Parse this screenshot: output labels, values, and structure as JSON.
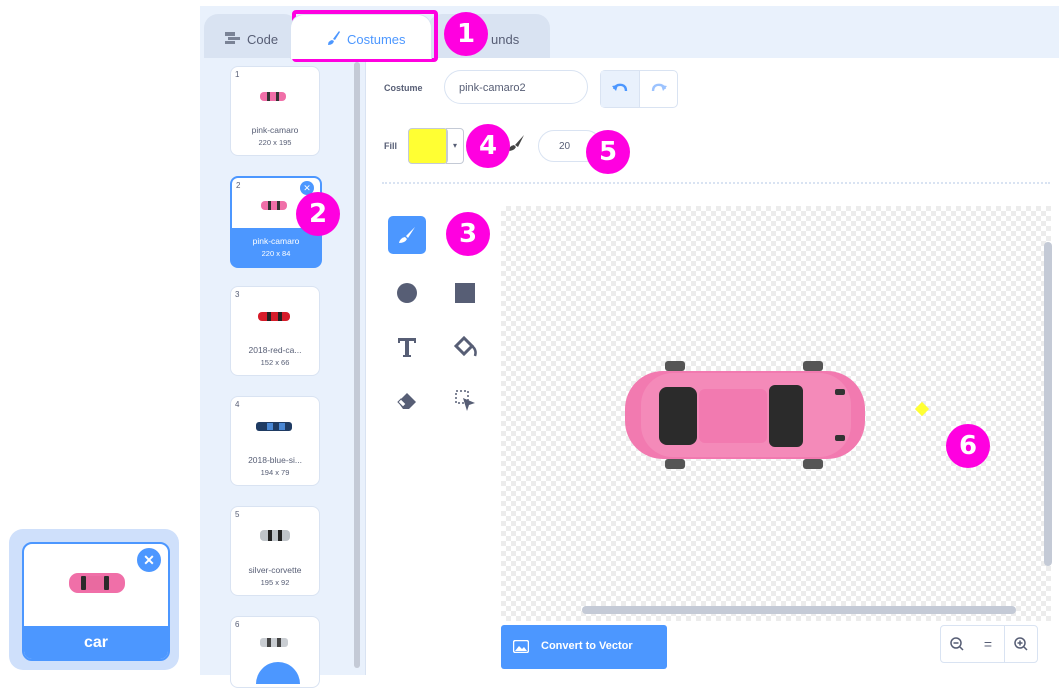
{
  "sprite": {
    "name": "car",
    "delete_icon": "close-x-icon"
  },
  "tabs": [
    {
      "label": "Code",
      "icon": "code-blocks-icon"
    },
    {
      "label": "Costumes",
      "icon": "paintbrush-icon"
    },
    {
      "label": "unds",
      "icon": "speaker-icon"
    }
  ],
  "costumes": [
    {
      "num": "1",
      "name": "pink-camaro",
      "size": "220 x 195"
    },
    {
      "num": "2",
      "name": "pink-camaro",
      "size": "220 x 84",
      "selected": true
    },
    {
      "num": "3",
      "name": "2018-red-ca...",
      "size": "152 x 66"
    },
    {
      "num": "4",
      "name": "2018-blue-si...",
      "size": "194 x 79"
    },
    {
      "num": "5",
      "name": "silver-corvette",
      "size": "195 x 92"
    },
    {
      "num": "6",
      "name": "",
      "size": ""
    }
  ],
  "editor": {
    "costume_label": "Costume",
    "costume_name": "pink-camaro2",
    "fill_label": "Fill",
    "fill_color": "#ffff33",
    "brush_size": "20",
    "convert_button": "Convert to Vector",
    "zoom_out": "−",
    "zoom_reset": "=",
    "zoom_in": "+"
  },
  "tools": [
    "brush-icon",
    "circle-icon",
    "rectangle-icon",
    "text-icon",
    "fill-bucket-icon",
    "eraser-icon",
    "select-icon"
  ],
  "annotations": [
    "1",
    "2",
    "3",
    "4",
    "5",
    "6"
  ],
  "colors": {
    "accent": "#4c97ff",
    "annotation": "#ff00e0",
    "car": "#f06fa8"
  }
}
